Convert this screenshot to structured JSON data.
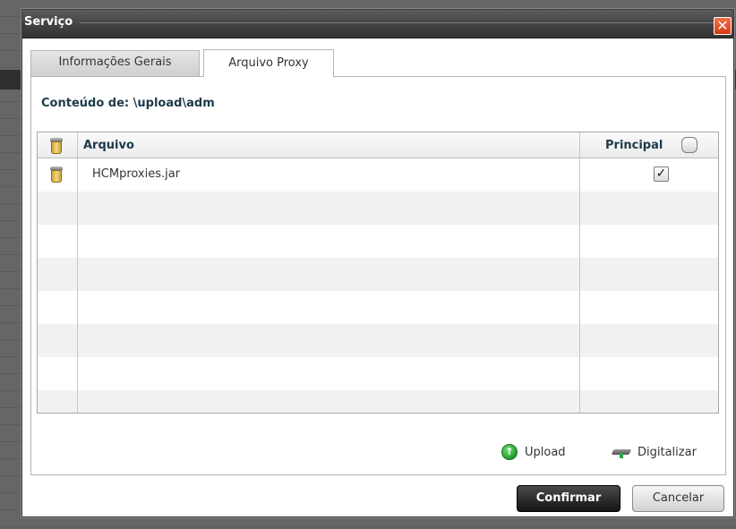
{
  "dialog": {
    "title": "Serviço",
    "close_label": "✕"
  },
  "tabs": [
    {
      "label": "Informações Gerais",
      "active": false
    },
    {
      "label": "Arquivo Proxy",
      "active": true
    }
  ],
  "content": {
    "label_prefix": "Conteúdo de:",
    "path": "\\upload\\adm"
  },
  "grid": {
    "columns": {
      "delete_icon": "trash-icon",
      "file": "Arquivo",
      "principal": "Principal"
    },
    "principal_header_checked": false,
    "rows": [
      {
        "file": "HCMproxies.jar",
        "principal": true
      }
    ]
  },
  "actions": {
    "upload_label": "Upload",
    "scan_label": "Digitalizar"
  },
  "buttons": {
    "confirm": "Confirmar",
    "cancel": "Cancelar"
  },
  "colors": {
    "title_bar": "#424242",
    "close_button": "#d63a14",
    "header_text": "#1c3a4a",
    "primary_button": "#141414",
    "upload_icon": "#1f9a2b"
  }
}
